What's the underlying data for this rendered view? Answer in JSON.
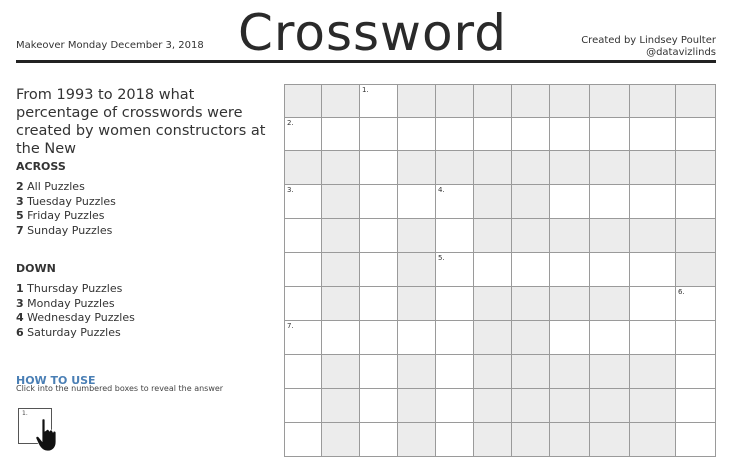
{
  "header": {
    "left_text": "Makeover Monday December 3, 2018",
    "title": "Crossword",
    "right_line1": "Created by Lindsey Poulter",
    "right_line2": "@datavizlinds"
  },
  "question": "From 1993 to 2018 what percentage of crosswords were created by women constructors at the New",
  "across": {
    "heading": "ACROSS",
    "clues": [
      {
        "num": "2",
        "text": " All Puzzles"
      },
      {
        "num": "3",
        "text": " Tuesday Puzzles"
      },
      {
        "num": "5",
        "text": " Friday Puzzles"
      },
      {
        "num": "7",
        "text": " Sunday Puzzles"
      }
    ]
  },
  "down": {
    "heading": "DOWN",
    "clues": [
      {
        "num": "1",
        "text": " Thursday Puzzles"
      },
      {
        "num": "3",
        "text": " Monday Puzzles"
      },
      {
        "num": "4",
        "text": " Wednesday Puzzles"
      },
      {
        "num": "6",
        "text": " Saturday Puzzles"
      }
    ]
  },
  "how_to_use": {
    "heading": "HOW TO USE",
    "text": "Click into the numbered boxes to reveal the answer",
    "demo_number": "1."
  },
  "grid": {
    "rows": 11,
    "cols": 11,
    "shaded": [
      [
        0,
        0
      ],
      [
        0,
        1
      ],
      [
        0,
        3
      ],
      [
        0,
        4
      ],
      [
        0,
        5
      ],
      [
        0,
        6
      ],
      [
        0,
        7
      ],
      [
        0,
        8
      ],
      [
        0,
        9
      ],
      [
        0,
        10
      ],
      [
        2,
        0
      ],
      [
        2,
        1
      ],
      [
        2,
        3
      ],
      [
        2,
        4
      ],
      [
        2,
        5
      ],
      [
        2,
        6
      ],
      [
        2,
        7
      ],
      [
        2,
        8
      ],
      [
        2,
        9
      ],
      [
        2,
        10
      ],
      [
        3,
        1
      ],
      [
        3,
        5
      ],
      [
        3,
        6
      ],
      [
        4,
        1
      ],
      [
        4,
        3
      ],
      [
        4,
        5
      ],
      [
        4,
        6
      ],
      [
        4,
        7
      ],
      [
        4,
        8
      ],
      [
        4,
        9
      ],
      [
        4,
        10
      ],
      [
        5,
        1
      ],
      [
        5,
        3
      ],
      [
        5,
        10
      ],
      [
        6,
        1
      ],
      [
        6,
        3
      ],
      [
        6,
        5
      ],
      [
        6,
        6
      ],
      [
        6,
        7
      ],
      [
        6,
        8
      ],
      [
        7,
        5
      ],
      [
        7,
        6
      ],
      [
        8,
        1
      ],
      [
        8,
        3
      ],
      [
        8,
        5
      ],
      [
        8,
        6
      ],
      [
        8,
        7
      ],
      [
        8,
        8
      ],
      [
        8,
        9
      ],
      [
        9,
        1
      ],
      [
        9,
        3
      ],
      [
        9,
        5
      ],
      [
        9,
        6
      ],
      [
        9,
        7
      ],
      [
        9,
        8
      ],
      [
        9,
        9
      ],
      [
        10,
        1
      ],
      [
        10,
        3
      ],
      [
        10,
        5
      ],
      [
        10,
        6
      ],
      [
        10,
        7
      ],
      [
        10,
        8
      ],
      [
        10,
        9
      ]
    ],
    "numbers": [
      {
        "row": 0,
        "col": 2,
        "label": "1."
      },
      {
        "row": 1,
        "col": 0,
        "label": "2."
      },
      {
        "row": 3,
        "col": 0,
        "label": "3."
      },
      {
        "row": 3,
        "col": 4,
        "label": "4."
      },
      {
        "row": 5,
        "col": 4,
        "label": "5."
      },
      {
        "row": 6,
        "col": 10,
        "label": "6."
      },
      {
        "row": 7,
        "col": 0,
        "label": "7."
      }
    ]
  }
}
